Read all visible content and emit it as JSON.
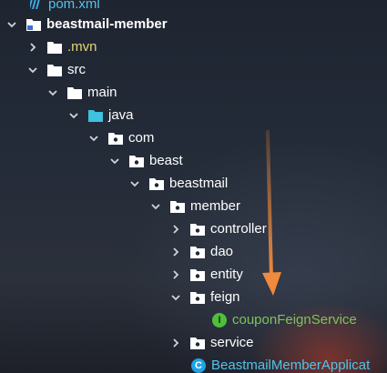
{
  "project_tree": {
    "items": [
      {
        "label": "pom.xml",
        "icon": "maven-icon",
        "expanded": null
      },
      {
        "label": "beastmail-member",
        "icon": "module-folder-icon",
        "expanded": true
      },
      {
        "label": ".mvn",
        "icon": "folder-icon",
        "expanded": false
      },
      {
        "label": "src",
        "icon": "folder-icon",
        "expanded": true
      },
      {
        "label": "main",
        "icon": "folder-icon",
        "expanded": true
      },
      {
        "label": "java",
        "icon": "source-root-folder-icon",
        "expanded": true
      },
      {
        "label": "com",
        "icon": "package-icon",
        "expanded": true
      },
      {
        "label": "beast",
        "icon": "package-icon",
        "expanded": true
      },
      {
        "label": "beastmail",
        "icon": "package-icon",
        "expanded": true
      },
      {
        "label": "member",
        "icon": "package-icon",
        "expanded": true
      },
      {
        "label": "controller",
        "icon": "package-icon",
        "expanded": false
      },
      {
        "label": "dao",
        "icon": "package-icon",
        "expanded": false
      },
      {
        "label": "entity",
        "icon": "package-icon",
        "expanded": false
      },
      {
        "label": "feign",
        "icon": "package-icon",
        "expanded": true
      },
      {
        "label": "couponFeignService",
        "icon": "interface-icon",
        "badge": "I",
        "expanded": null
      },
      {
        "label": "service",
        "icon": "package-icon",
        "expanded": false
      },
      {
        "label": "BeastmailMemberApplicat",
        "icon": "spring-class-icon",
        "badge": "C",
        "expanded": null
      }
    ]
  },
  "colors": {
    "accent_arrow": "#f08a3c",
    "interface_badge": "#4fbf3a",
    "class_badge": "#1fa3e6",
    "source_root": "#3fc1e0",
    "excluded_text": "#e0d77a",
    "interface_text": "#7ec35e"
  }
}
